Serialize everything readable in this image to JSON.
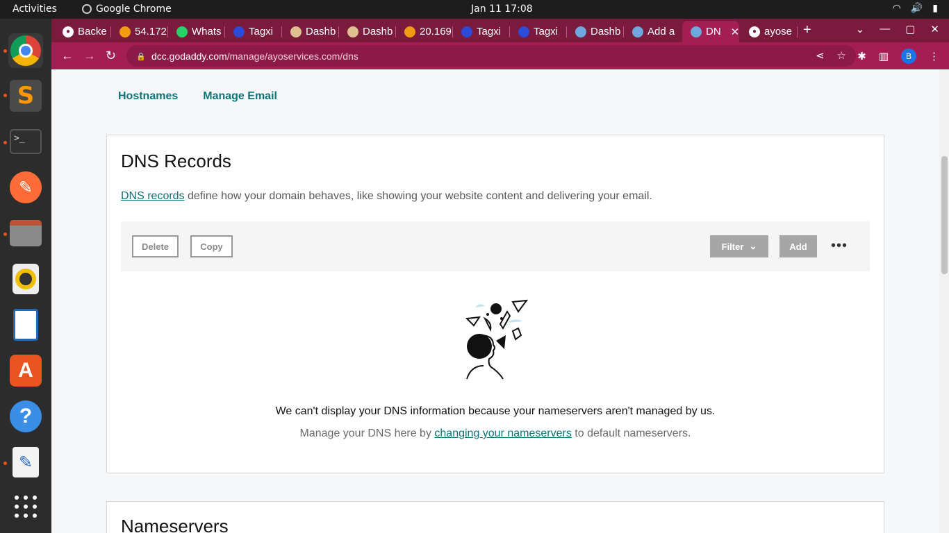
{
  "system": {
    "activities": "Activities",
    "app_name": "Google Chrome",
    "clock": "Jan 11  17:08"
  },
  "tabs": [
    {
      "label": "Backe",
      "icon": "globe-icon"
    },
    {
      "label": "54.172",
      "icon": "aws-icon"
    },
    {
      "label": "Whats",
      "icon": "whatsapp-icon"
    },
    {
      "label": "Tagxi",
      "icon": "shield-icon"
    },
    {
      "label": "Dashb",
      "icon": "avatar-icon"
    },
    {
      "label": "Dashb",
      "icon": "avatar-icon"
    },
    {
      "label": "20.169",
      "icon": "aws-icon"
    },
    {
      "label": "Tagxi",
      "icon": "shield-icon"
    },
    {
      "label": "Tagxi",
      "icon": "shield-icon"
    },
    {
      "label": "Dashb",
      "icon": "godaddy-icon"
    },
    {
      "label": "Add a",
      "icon": "godaddy-icon"
    },
    {
      "label": "DN",
      "icon": "godaddy-icon",
      "active": true
    },
    {
      "label": "ayose",
      "icon": "globe-icon"
    }
  ],
  "browser": {
    "url_host": "dcc.godaddy.com",
    "url_path": "/manage/ayoservices.com/dns",
    "profile_initial": "B"
  },
  "subnav": {
    "hostnames": "Hostnames",
    "manage_email": "Manage Email"
  },
  "dns": {
    "title": "DNS Records",
    "desc_link": "DNS records",
    "desc_rest": " define how your domain behaves, like showing your website content and delivering your email.",
    "delete_label": "Delete",
    "copy_label": "Copy",
    "filter_label": "Filter",
    "add_label": "Add",
    "more_label": "•••",
    "message": "We can't display your DNS information because your nameservers aren't managed by us.",
    "sub_prefix": "Manage your DNS here by ",
    "sub_link": "changing your nameservers",
    "sub_suffix": " to default nameservers."
  },
  "nameservers": {
    "title": "Nameservers"
  },
  "colors": {
    "tab_strip": "#7a1a3c",
    "toolbar": "#a51e53",
    "link": "#0e7379"
  }
}
